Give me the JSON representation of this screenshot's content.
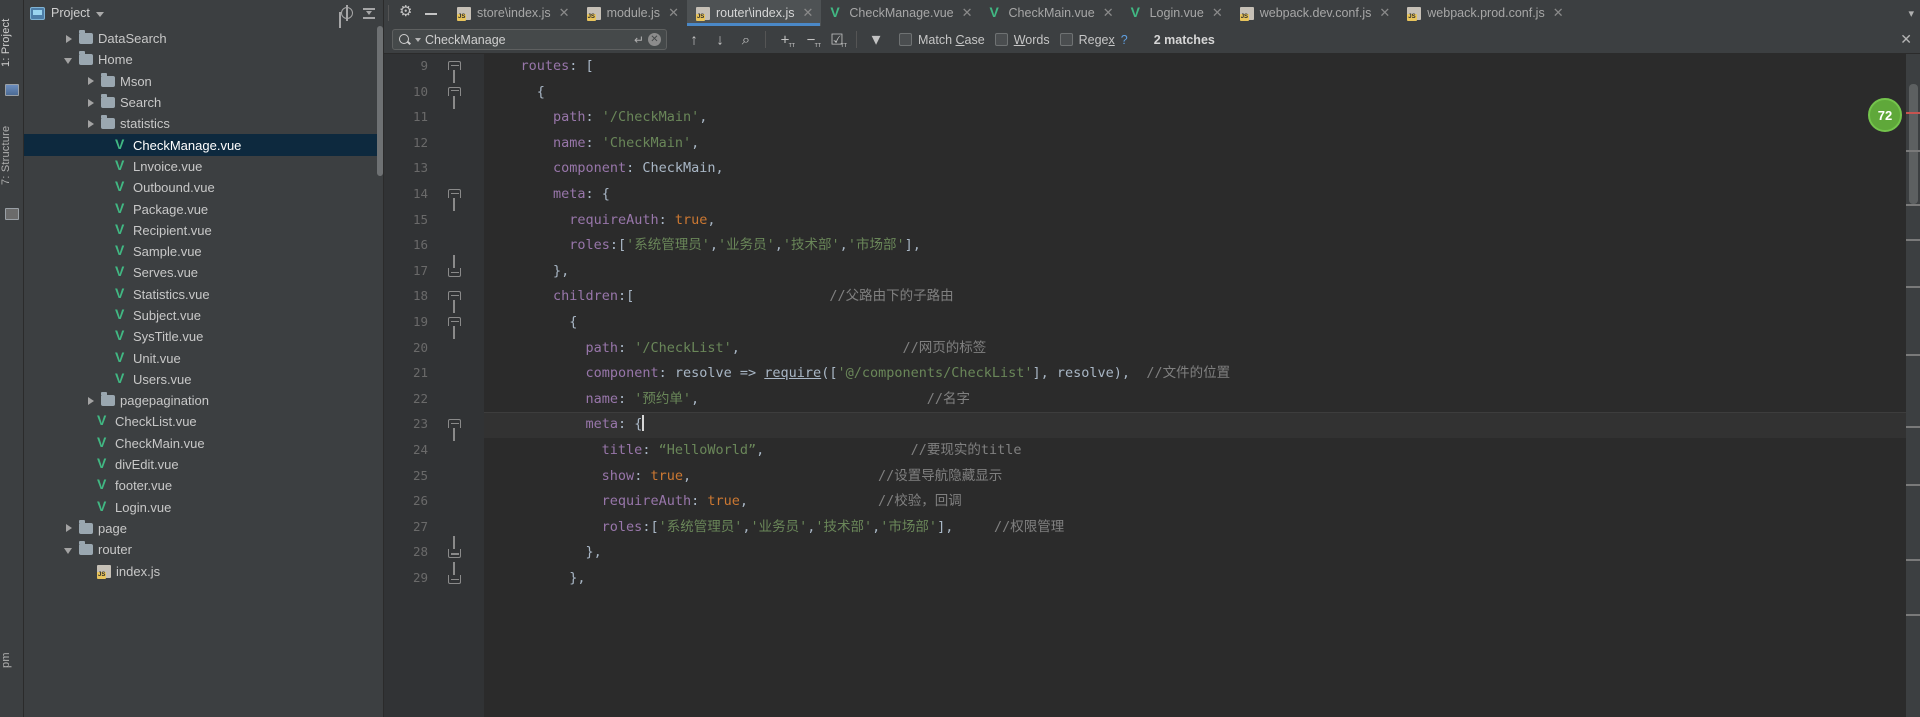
{
  "left_strip": {
    "tabs": [
      {
        "name": "project",
        "label": "1: Project"
      },
      {
        "name": "structure",
        "label": "7: Structure"
      },
      {
        "name": "pm",
        "label": "pm"
      }
    ]
  },
  "project_panel": {
    "title": "Project",
    "icons": {
      "locate": "target-icon",
      "collapse": "collapse-all-icon",
      "settings": "gear-icon",
      "hide": "hide-icon"
    },
    "tree": [
      {
        "label": "DataSearch",
        "type": "folder",
        "arrow": "right",
        "indent": 1,
        "selected": false
      },
      {
        "label": "Home",
        "type": "folder",
        "arrow": "down",
        "indent": 1,
        "selected": false
      },
      {
        "label": "Mson",
        "type": "folder",
        "arrow": "right",
        "indent": 2,
        "selected": false
      },
      {
        "label": "Search",
        "type": "folder",
        "arrow": "right",
        "indent": 2,
        "selected": false
      },
      {
        "label": "statistics",
        "type": "folder",
        "arrow": "right",
        "indent": 2,
        "selected": false
      },
      {
        "label": "CheckManage.vue",
        "type": "vue",
        "arrow": "none",
        "indent": 3,
        "selected": true
      },
      {
        "label": "Lnvoice.vue",
        "type": "vue",
        "arrow": "none",
        "indent": 3,
        "selected": false
      },
      {
        "label": "Outbound.vue",
        "type": "vue",
        "arrow": "none",
        "indent": 3,
        "selected": false
      },
      {
        "label": "Package.vue",
        "type": "vue",
        "arrow": "none",
        "indent": 3,
        "selected": false
      },
      {
        "label": "Recipient.vue",
        "type": "vue",
        "arrow": "none",
        "indent": 3,
        "selected": false
      },
      {
        "label": "Sample.vue",
        "type": "vue",
        "arrow": "none",
        "indent": 3,
        "selected": false
      },
      {
        "label": "Serves.vue",
        "type": "vue",
        "arrow": "none",
        "indent": 3,
        "selected": false
      },
      {
        "label": "Statistics.vue",
        "type": "vue",
        "arrow": "none",
        "indent": 3,
        "selected": false
      },
      {
        "label": "Subject.vue",
        "type": "vue",
        "arrow": "none",
        "indent": 3,
        "selected": false
      },
      {
        "label": "SysTitle.vue",
        "type": "vue",
        "arrow": "none",
        "indent": 3,
        "selected": false
      },
      {
        "label": "Unit.vue",
        "type": "vue",
        "arrow": "none",
        "indent": 3,
        "selected": false
      },
      {
        "label": "Users.vue",
        "type": "vue",
        "arrow": "none",
        "indent": 3,
        "selected": false
      },
      {
        "label": "pagepagination",
        "type": "folder",
        "arrow": "right",
        "indent": 2,
        "selected": false
      },
      {
        "label": "CheckList.vue",
        "type": "vue",
        "arrow": "none",
        "indent": 2,
        "selected": false
      },
      {
        "label": "CheckMain.vue",
        "type": "vue",
        "arrow": "none",
        "indent": 2,
        "selected": false
      },
      {
        "label": "divEdit.vue",
        "type": "vue",
        "arrow": "none",
        "indent": 2,
        "selected": false
      },
      {
        "label": "footer.vue",
        "type": "vue",
        "arrow": "none",
        "indent": 2,
        "selected": false
      },
      {
        "label": "Login.vue",
        "type": "vue",
        "arrow": "none",
        "indent": 2,
        "selected": false
      },
      {
        "label": "page",
        "type": "folder",
        "arrow": "right",
        "indent": 1,
        "selected": false
      },
      {
        "label": "router",
        "type": "folder",
        "arrow": "down",
        "indent": 1,
        "selected": false
      },
      {
        "label": "index.js",
        "type": "js",
        "arrow": "none",
        "indent": 2,
        "selected": false
      }
    ]
  },
  "tabbar": {
    "gear": "gear-icon",
    "minimize": "minimize-icon",
    "overflow": "tab-overflow-chevron",
    "tabs": [
      {
        "label": "store\\index.js",
        "type": "js",
        "active": false
      },
      {
        "label": "module.js",
        "type": "js",
        "active": false
      },
      {
        "label": "router\\index.js",
        "type": "js",
        "active": true
      },
      {
        "label": "CheckManage.vue",
        "type": "vue",
        "active": false
      },
      {
        "label": "CheckMain.vue",
        "type": "vue",
        "active": false
      },
      {
        "label": "Login.vue",
        "type": "vue",
        "active": false
      },
      {
        "label": "webpack.dev.conf.js",
        "type": "js",
        "active": false
      },
      {
        "label": "webpack.prod.conf.js",
        "type": "js",
        "active": false
      }
    ]
  },
  "findbar": {
    "search_value": "CheckManage",
    "search_placeholder": "Search",
    "enter_hint": "↵",
    "clear_label": "✕",
    "buttons": [
      {
        "name": "find-previous",
        "glyph": "↑",
        "sub": ""
      },
      {
        "name": "find-next",
        "glyph": "↓",
        "sub": ""
      },
      {
        "name": "find-in-path",
        "glyph": "⌕",
        "sub": ""
      },
      {
        "name": "expand-all",
        "glyph": "+",
        "sub": "ᴛᴛ"
      },
      {
        "name": "collapse-all",
        "glyph": "−",
        "sub": "ᴛᴛ"
      },
      {
        "name": "select-all-occurrences",
        "glyph": "☑",
        "sub": "ᴛᴛ"
      },
      {
        "name": "filter",
        "glyph": "▼",
        "sub": ""
      }
    ],
    "checkboxes": [
      {
        "label": "Match Case",
        "mnemonic": "C",
        "checked": false
      },
      {
        "label": "Words",
        "mnemonic": "W",
        "checked": false
      },
      {
        "label": "Regex",
        "mnemonic": "x",
        "checked": false
      }
    ],
    "help": "?",
    "matches": "2 matches",
    "close": "✕"
  },
  "editor": {
    "current_line": 23,
    "inspection_badge": "72",
    "lines": [
      {
        "no": 9,
        "fold": "open",
        "indent": 4,
        "tokens": [
          {
            "t": "routes",
            "c": "prop"
          },
          {
            "t": ": [",
            "c": "punc"
          }
        ]
      },
      {
        "no": 10,
        "fold": "open",
        "indent": 6,
        "tokens": [
          {
            "t": "{",
            "c": "punc"
          }
        ]
      },
      {
        "no": 11,
        "fold": "none",
        "indent": 8,
        "tokens": [
          {
            "t": "path",
            "c": "prop"
          },
          {
            "t": ": ",
            "c": "punc"
          },
          {
            "t": "'/CheckMain'",
            "c": "str"
          },
          {
            "t": ",",
            "c": "punc"
          }
        ]
      },
      {
        "no": 12,
        "fold": "none",
        "indent": 8,
        "tokens": [
          {
            "t": "name",
            "c": "prop"
          },
          {
            "t": ": ",
            "c": "punc"
          },
          {
            "t": "'CheckMain'",
            "c": "str"
          },
          {
            "t": ",",
            "c": "punc"
          }
        ]
      },
      {
        "no": 13,
        "fold": "none",
        "indent": 8,
        "tokens": [
          {
            "t": "component",
            "c": "prop"
          },
          {
            "t": ": CheckMain,",
            "c": "punc"
          }
        ]
      },
      {
        "no": 14,
        "fold": "open",
        "indent": 8,
        "tokens": [
          {
            "t": "meta",
            "c": "prop"
          },
          {
            "t": ": {",
            "c": "punc"
          }
        ]
      },
      {
        "no": 15,
        "fold": "none",
        "indent": 10,
        "tokens": [
          {
            "t": "requireAuth",
            "c": "prop"
          },
          {
            "t": ": ",
            "c": "punc"
          },
          {
            "t": "true",
            "c": "kw"
          },
          {
            "t": ",",
            "c": "punc"
          }
        ]
      },
      {
        "no": 16,
        "fold": "none",
        "indent": 10,
        "tokens": [
          {
            "t": "roles",
            "c": "prop"
          },
          {
            "t": ":[",
            "c": "punc"
          },
          {
            "t": "'系统管理员'",
            "c": "str"
          },
          {
            "t": ",",
            "c": "punc"
          },
          {
            "t": "'业务员'",
            "c": "str"
          },
          {
            "t": ",",
            "c": "punc"
          },
          {
            "t": "'技术部'",
            "c": "str"
          },
          {
            "t": ",",
            "c": "punc"
          },
          {
            "t": "'市场部'",
            "c": "str"
          },
          {
            "t": "],",
            "c": "punc"
          }
        ]
      },
      {
        "no": 17,
        "fold": "close",
        "indent": 8,
        "tokens": [
          {
            "t": "},",
            "c": "punc"
          }
        ]
      },
      {
        "no": 18,
        "fold": "open",
        "indent": 8,
        "tokens": [
          {
            "t": "children",
            "c": "prop"
          },
          {
            "t": ":[",
            "c": "punc"
          },
          {
            "t": "                        ",
            "c": "punc"
          },
          {
            "t": "//父路由下的子路由",
            "c": "cmt"
          }
        ]
      },
      {
        "no": 19,
        "fold": "open",
        "indent": 10,
        "tokens": [
          {
            "t": "{",
            "c": "punc"
          }
        ]
      },
      {
        "no": 20,
        "fold": "none",
        "indent": 12,
        "tokens": [
          {
            "t": "path",
            "c": "prop"
          },
          {
            "t": ": ",
            "c": "punc"
          },
          {
            "t": "'/CheckList'",
            "c": "str"
          },
          {
            "t": ",",
            "c": "punc"
          },
          {
            "t": "                    ",
            "c": "punc"
          },
          {
            "t": "//网页的标签",
            "c": "cmt"
          }
        ]
      },
      {
        "no": 21,
        "fold": "none",
        "indent": 12,
        "tokens": [
          {
            "t": "component",
            "c": "prop"
          },
          {
            "t": ": resolve ",
            "c": "punc"
          },
          {
            "t": "=>",
            "c": "op"
          },
          {
            "t": " ",
            "c": "punc"
          },
          {
            "t": "require",
            "c": "fn"
          },
          {
            "t": "([",
            "c": "punc"
          },
          {
            "t": "'@/components/CheckList'",
            "c": "str"
          },
          {
            "t": "], resolve),  ",
            "c": "punc"
          },
          {
            "t": "//文件的位置",
            "c": "cmt"
          }
        ]
      },
      {
        "no": 22,
        "fold": "none",
        "indent": 12,
        "tokens": [
          {
            "t": "name",
            "c": "prop"
          },
          {
            "t": ": ",
            "c": "punc"
          },
          {
            "t": "'预约单'",
            "c": "str"
          },
          {
            "t": ",",
            "c": "punc"
          },
          {
            "t": "                            ",
            "c": "punc"
          },
          {
            "t": "//名字",
            "c": "cmt"
          }
        ]
      },
      {
        "no": 23,
        "fold": "open",
        "indent": 12,
        "tokens": [
          {
            "t": "meta",
            "c": "prop"
          },
          {
            "t": ": ",
            "c": "punc"
          },
          {
            "t": "{",
            "c": "punc"
          },
          {
            "t": "|CURSOR|",
            "c": "cursor"
          }
        ]
      },
      {
        "no": 24,
        "fold": "none",
        "indent": 14,
        "tokens": [
          {
            "t": "title",
            "c": "prop"
          },
          {
            "t": ": ",
            "c": "punc"
          },
          {
            "t": "“HelloWorld”",
            "c": "str"
          },
          {
            "t": ",",
            "c": "punc"
          },
          {
            "t": "                  ",
            "c": "punc"
          },
          {
            "t": "//要现实的title",
            "c": "cmt"
          }
        ]
      },
      {
        "no": 25,
        "fold": "none",
        "indent": 14,
        "tokens": [
          {
            "t": "show",
            "c": "prop"
          },
          {
            "t": ": ",
            "c": "punc"
          },
          {
            "t": "true",
            "c": "kw"
          },
          {
            "t": ",",
            "c": "punc"
          },
          {
            "t": "                       ",
            "c": "punc"
          },
          {
            "t": "//设置导航隐藏显示",
            "c": "cmt"
          }
        ]
      },
      {
        "no": 26,
        "fold": "none",
        "indent": 14,
        "tokens": [
          {
            "t": "requireAuth",
            "c": "prop"
          },
          {
            "t": ": ",
            "c": "punc"
          },
          {
            "t": "true",
            "c": "kw"
          },
          {
            "t": ",",
            "c": "punc"
          },
          {
            "t": "                ",
            "c": "punc"
          },
          {
            "t": "//校验，回调",
            "c": "cmt"
          }
        ]
      },
      {
        "no": 27,
        "fold": "none",
        "indent": 14,
        "tokens": [
          {
            "t": "roles",
            "c": "prop"
          },
          {
            "t": ":[",
            "c": "punc"
          },
          {
            "t": "'系统管理员'",
            "c": "str"
          },
          {
            "t": ",",
            "c": "punc"
          },
          {
            "t": "'业务员'",
            "c": "str"
          },
          {
            "t": ",",
            "c": "punc"
          },
          {
            "t": "'技术部'",
            "c": "str"
          },
          {
            "t": ",",
            "c": "punc"
          },
          {
            "t": "'市场部'",
            "c": "str"
          },
          {
            "t": "],",
            "c": "punc"
          },
          {
            "t": "     ",
            "c": "punc"
          },
          {
            "t": "//权限管理",
            "c": "cmt"
          }
        ]
      },
      {
        "no": 28,
        "fold": "close",
        "indent": 12,
        "tokens": [
          {
            "t": "},",
            "c": "punc"
          }
        ]
      },
      {
        "no": 29,
        "fold": "close",
        "indent": 10,
        "tokens": [
          {
            "t": "},",
            "c": "punc"
          }
        ]
      }
    ]
  },
  "colors": {
    "accent_tab": "#4a88c7",
    "selection": "#0d293e",
    "string": "#6a8759",
    "property": "#9876aa",
    "keyword": "#cc7832",
    "comment": "#808080",
    "vue_green": "#41b883",
    "badge_green": "#5fa83a"
  }
}
